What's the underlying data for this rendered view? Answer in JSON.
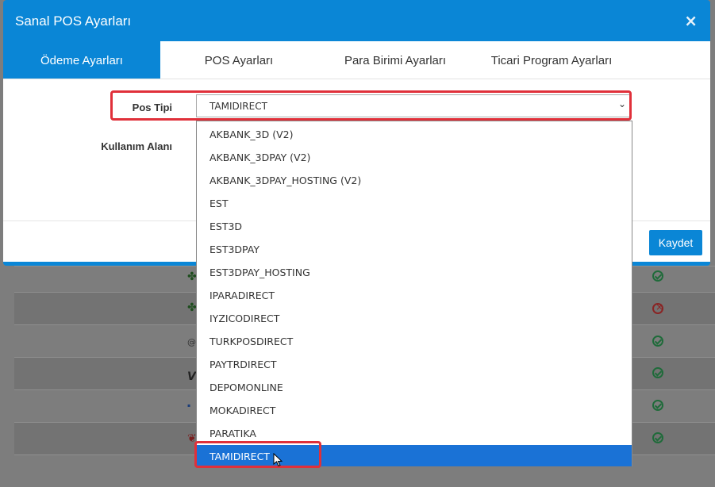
{
  "modal": {
    "title": "Sanal POS Ayarları",
    "close_label": "×",
    "tabs": [
      {
        "label": "Ödeme Ayarları",
        "active": true
      },
      {
        "label": "POS Ayarları",
        "active": false
      },
      {
        "label": "Para Birimi Ayarları",
        "active": false
      },
      {
        "label": "Ticari Program Ayarları",
        "active": false
      }
    ],
    "form": {
      "pos_type_label": "Pos Tipi",
      "pos_type_value": "TAMIDIRECT",
      "usage_area_label": "Kullanım Alanı"
    },
    "save_label": "Kaydet"
  },
  "dropdown": {
    "options": [
      "AKBANK_3D (V2)",
      "AKBANK_3DPAY (V2)",
      "AKBANK_3DPAY_HOSTING (V2)",
      "EST",
      "EST3D",
      "EST3DPAY",
      "EST3DPAY_HOSTING",
      "IPARADIRECT",
      "IYZICODIRECT",
      "TURKPOSDIRECT",
      "PAYTRDIRECT",
      "DEPOMONLINE",
      "MOKADIRECT",
      "PARATIKA",
      "TAMIDIRECT"
    ],
    "selected": "TAMIDIRECT"
  },
  "colors": {
    "accent": "#0a86d6",
    "selection": "#1a72d6",
    "highlight": "#e0303a",
    "overlay": "#7d7d7d"
  }
}
